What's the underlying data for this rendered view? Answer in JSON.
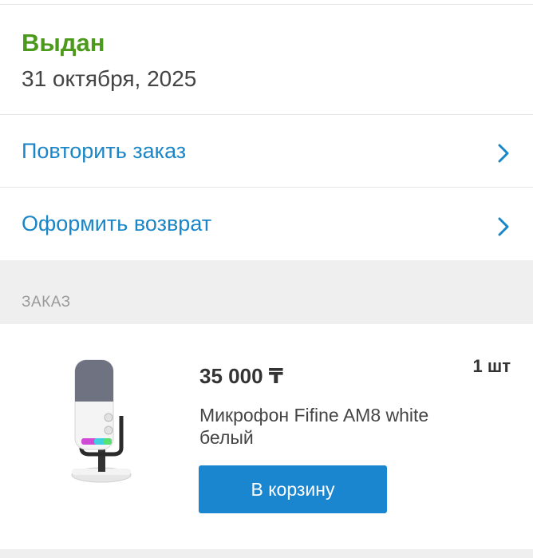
{
  "status": {
    "title": "Выдан",
    "date": "31 октября, 2025",
    "title_color": "#4c9a1b"
  },
  "actions": [
    {
      "label": "Повторить заказ",
      "icon": "chevron-right-icon"
    },
    {
      "label": "Оформить возврат",
      "icon": "chevron-right-icon"
    }
  ],
  "order_section": {
    "label": "ЗАКАЗ"
  },
  "item": {
    "image": "microphone-image",
    "price": "35 000 ₸",
    "quantity": "1 шт",
    "name": "Микрофон Fifine AM8 white белый",
    "cart_button": "В корзину"
  },
  "colors": {
    "accent": "#1a86c7",
    "button": "#1a86d0",
    "section_bg": "#efefef"
  }
}
